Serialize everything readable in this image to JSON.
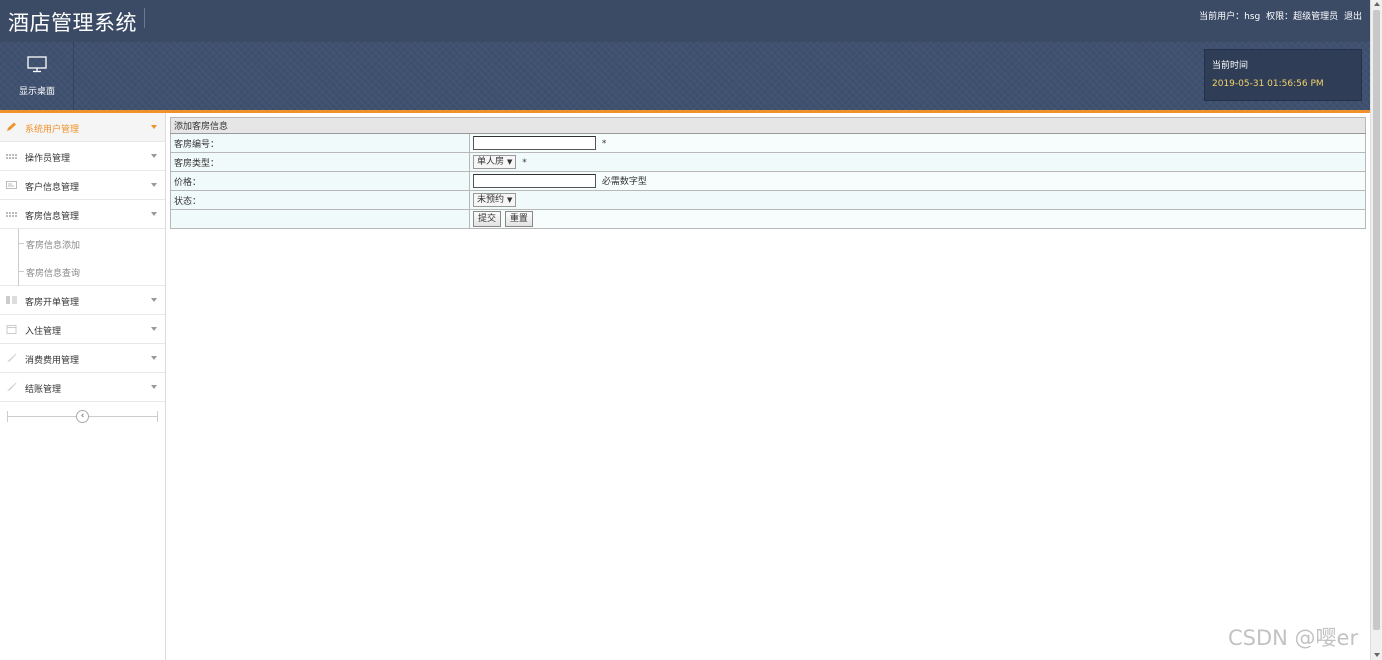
{
  "header": {
    "app_title": "酒店管理系统",
    "current_user_label": "当前用户：hsg",
    "permission_label": "权限：超级管理员",
    "logout": "退出"
  },
  "banner": {
    "desktop_label": "显示桌面",
    "time_label": "当前时间",
    "time_value": "2019-05-31 01:56:56 PM"
  },
  "sidebar": {
    "items": [
      {
        "label": "系统用户管理",
        "icon": "pencil-icon",
        "active": true
      },
      {
        "label": "操作员管理",
        "icon": "grid-icon"
      },
      {
        "label": "客户信息管理",
        "icon": "card-icon"
      },
      {
        "label": "客房信息管理",
        "icon": "grid-icon"
      },
      {
        "label": "客房开单管理",
        "icon": "columns-icon"
      },
      {
        "label": "入住管理",
        "icon": "calendar-icon"
      },
      {
        "label": "消费费用管理",
        "icon": "brush-icon"
      },
      {
        "label": "结账管理",
        "icon": "brush-icon"
      }
    ],
    "subitems": [
      {
        "label": "客房信息添加"
      },
      {
        "label": "客房信息查询"
      }
    ],
    "collapse_icon": "chevron-left-icon"
  },
  "form": {
    "title": "添加客房信息",
    "room_no_label": "客房编号：",
    "room_no_value": "",
    "room_no_required": "*",
    "room_type_label": "客房类型：",
    "room_type_value": "单人房",
    "room_type_required": "*",
    "price_label": "价格：",
    "price_value": "",
    "price_hint": "必需数字型",
    "status_label": "状态：",
    "status_value": "未预约",
    "submit": "提交",
    "reset": "重置"
  },
  "watermark": "CSDN @嘤er",
  "colors": {
    "header_bg": "#3b4b66",
    "accent": "#f0922b",
    "time_text": "#f4d26b"
  }
}
